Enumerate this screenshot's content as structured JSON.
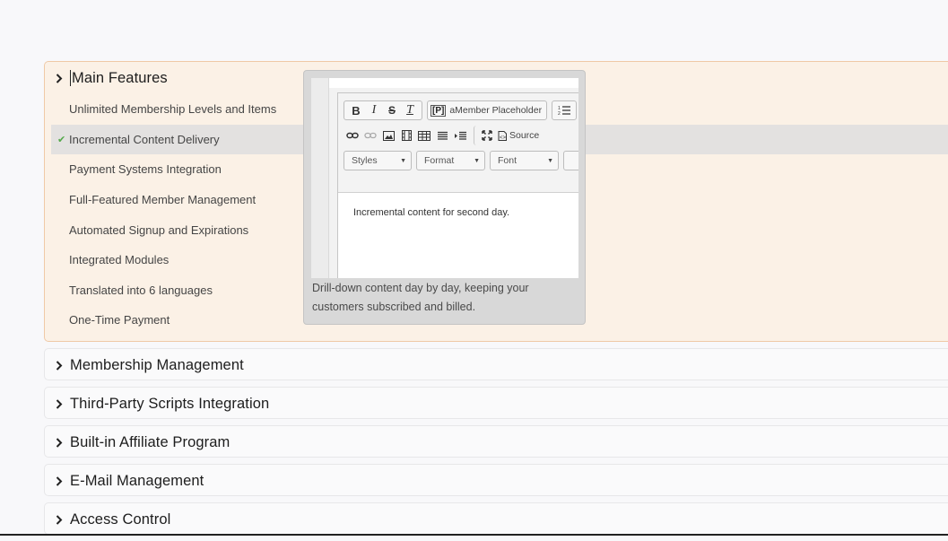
{
  "accordion": {
    "sections": [
      {
        "title": "Main Features",
        "open": true
      },
      {
        "title": "Membership Management"
      },
      {
        "title": "Third-Party Scripts Integration"
      },
      {
        "title": "Built-in Affiliate Program"
      },
      {
        "title": "E-Mail Management"
      },
      {
        "title": "Access Control"
      }
    ],
    "main_features": [
      "Unlimited Membership Levels and Items",
      "Incremental Content Delivery",
      "Payment Systems Integration",
      "Full-Featured Member Management",
      "Automated Signup and Expirations",
      "Integrated Modules",
      "Translated into 6 languages",
      "One-Time Payment"
    ],
    "active_feature": "Incremental Content Delivery"
  },
  "popup": {
    "editor": {
      "toolbar1": {
        "bold": "B",
        "italic": "I",
        "strike": "S",
        "clear_format": "T",
        "placeholder_badge": "[P]",
        "placeholder_label": "aMember Placeholder"
      },
      "toolbar2": {
        "source_label": "Source"
      },
      "toolbar3": {
        "styles": "Styles",
        "format": "Format",
        "font": "Font"
      },
      "content": "Incremental content for second day."
    },
    "caption": "Drill-down content day by day, keeping your customers subscribed and billed."
  },
  "icons": {
    "chevron": "chevron-right-icon",
    "check": "check-icon"
  },
  "colors": {
    "open_panel_bg": "#fbf1e6",
    "open_panel_border": "#efc9a6",
    "active_row_bg": "#e3e1e0",
    "check_green": "#53a84a"
  }
}
